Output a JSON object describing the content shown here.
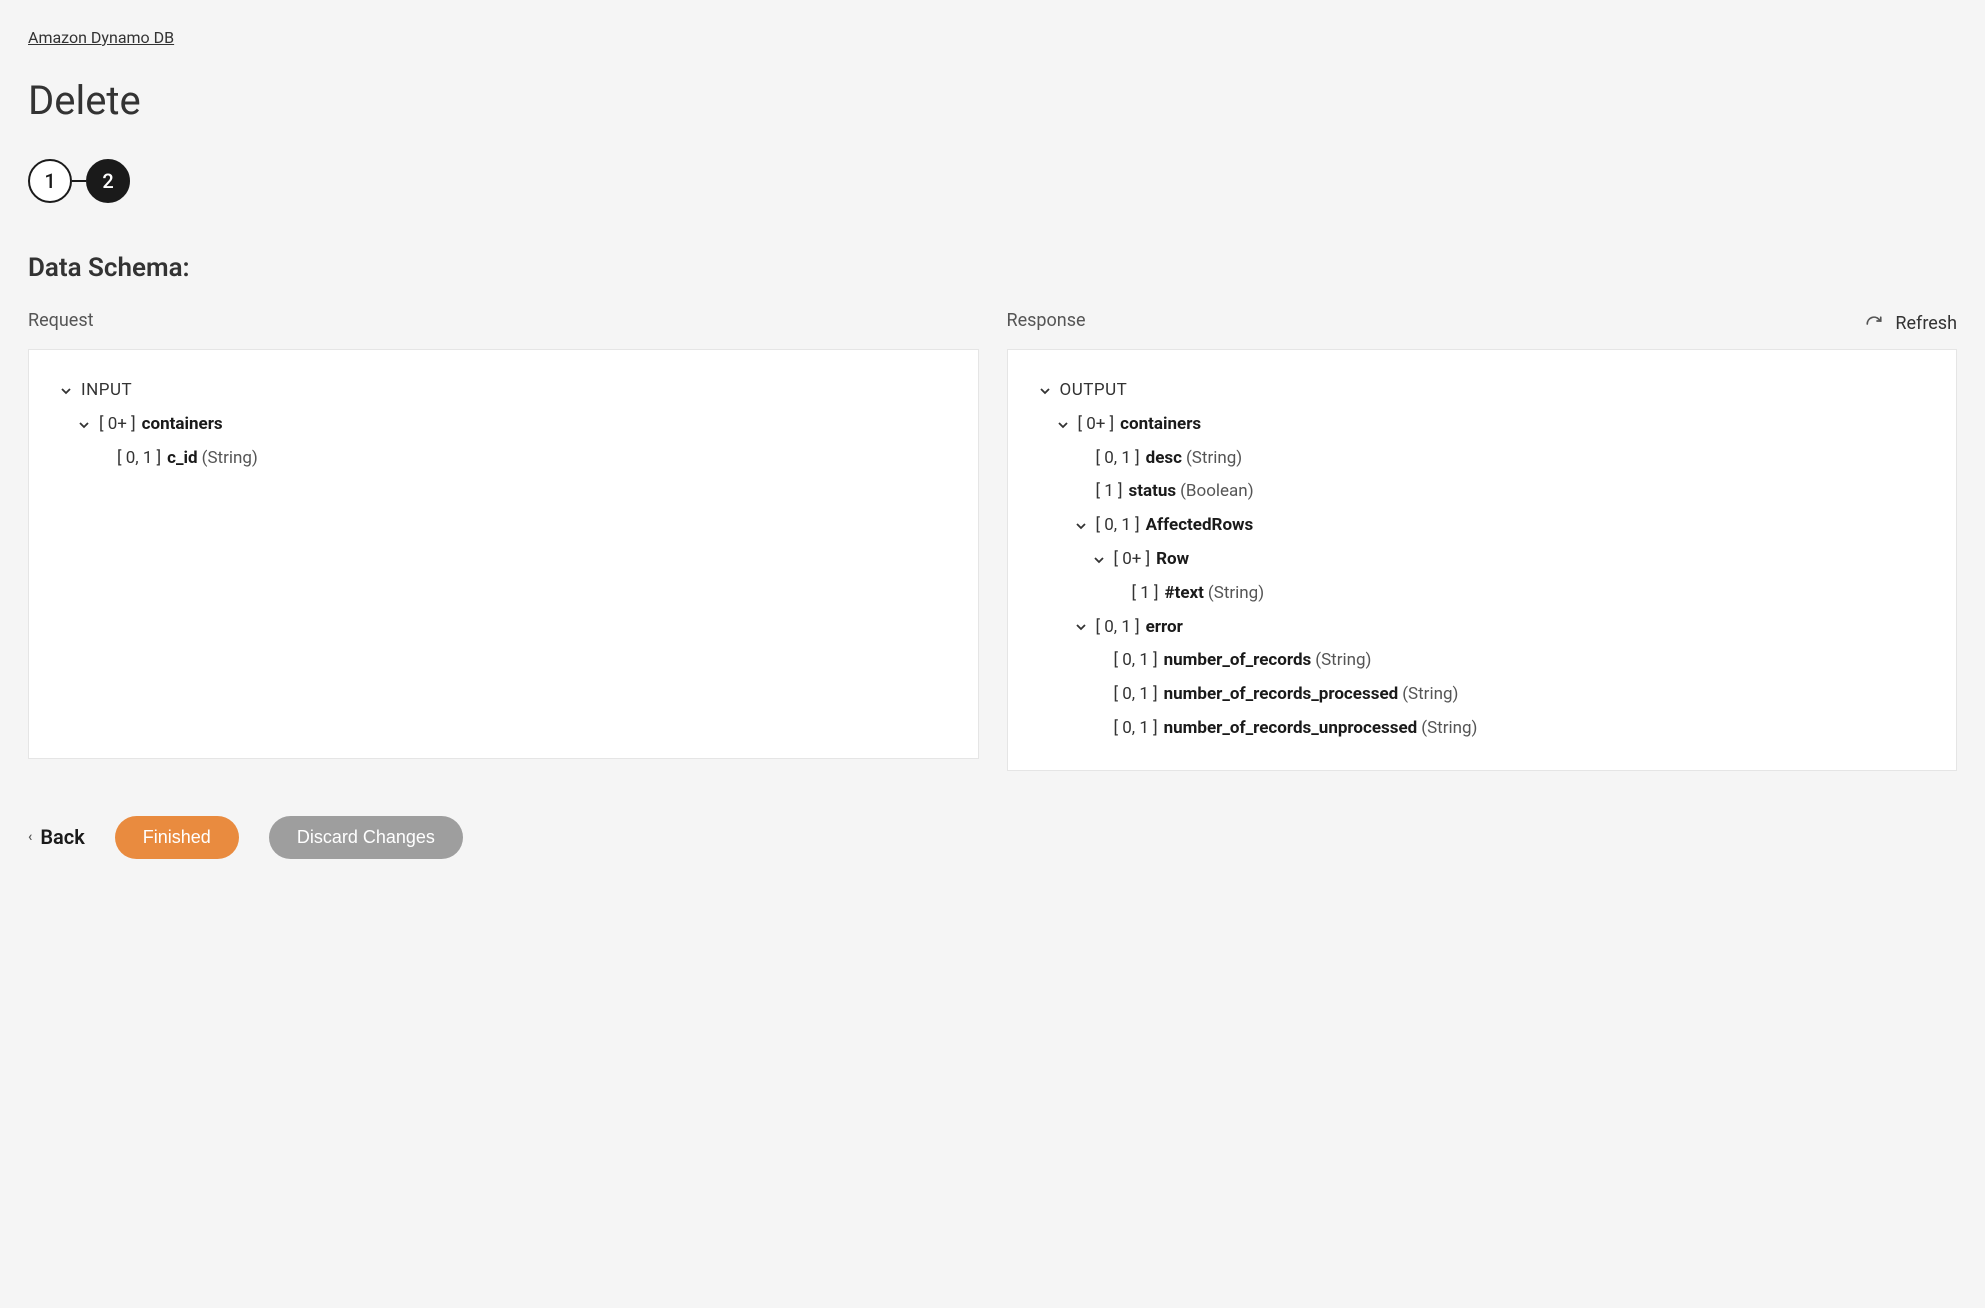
{
  "breadcrumb": "Amazon Dynamo DB",
  "page_title": "Delete",
  "stepper": {
    "step1": "1",
    "step2": "2"
  },
  "section_title": "Data Schema:",
  "refresh_label": "Refresh",
  "panels": {
    "request_label": "Request",
    "response_label": "Response"
  },
  "request_tree": {
    "root": "INPUT",
    "containers": {
      "card": "[ 0+ ]",
      "name": "containers"
    },
    "c_id": {
      "card": "[ 0, 1 ]",
      "name": "c_id",
      "type": "(String)"
    }
  },
  "response_tree": {
    "root": "OUTPUT",
    "containers": {
      "card": "[ 0+ ]",
      "name": "containers"
    },
    "desc": {
      "card": "[ 0, 1 ]",
      "name": "desc",
      "type": "(String)"
    },
    "status": {
      "card": "[ 1 ]",
      "name": "status",
      "type": "(Boolean)"
    },
    "affected": {
      "card": "[ 0, 1 ]",
      "name": "AffectedRows"
    },
    "row": {
      "card": "[ 0+ ]",
      "name": "Row"
    },
    "text": {
      "card": "[ 1 ]",
      "name": "#text",
      "type": "(String)"
    },
    "error": {
      "card": "[ 0, 1 ]",
      "name": "error"
    },
    "num_records": {
      "card": "[ 0, 1 ]",
      "name": "number_of_records",
      "type": "(String)"
    },
    "num_processed": {
      "card": "[ 0, 1 ]",
      "name": "number_of_records_processed",
      "type": "(String)"
    },
    "num_unprocessed": {
      "card": "[ 0, 1 ]",
      "name": "number_of_records_unprocessed",
      "type": "(String)"
    }
  },
  "footer": {
    "back": "Back",
    "finished": "Finished",
    "discard": "Discard Changes"
  }
}
